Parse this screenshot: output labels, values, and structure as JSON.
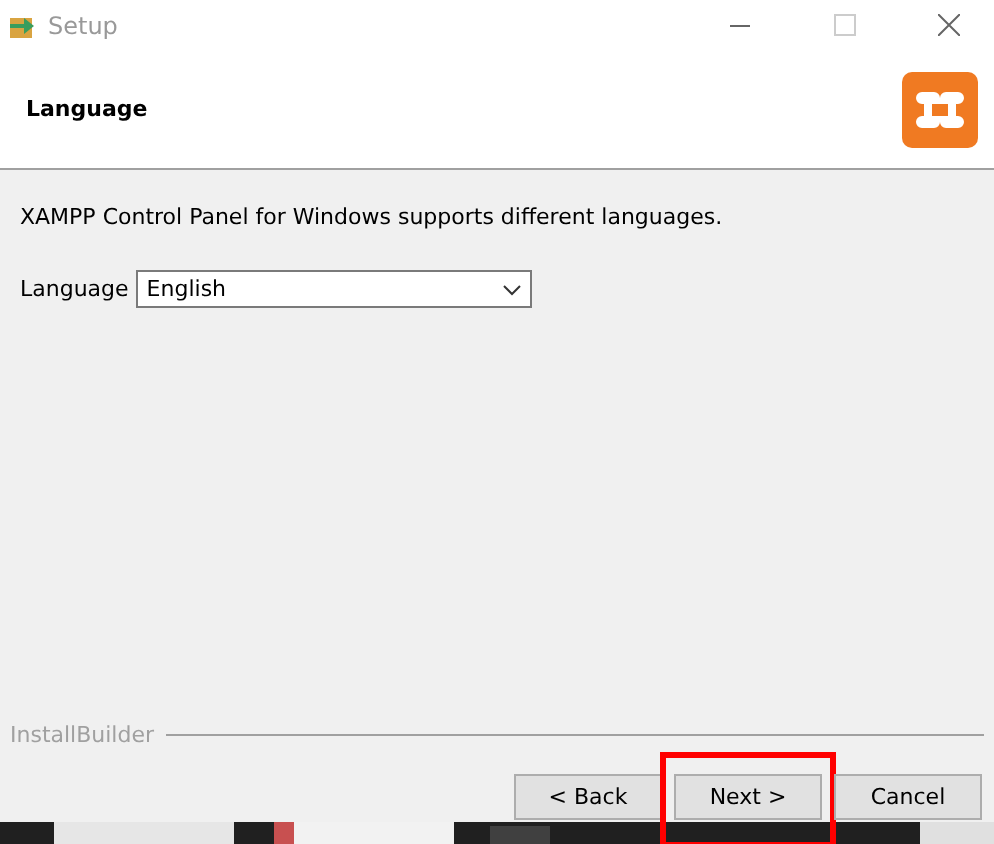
{
  "window": {
    "title": "Setup",
    "active": false
  },
  "header": {
    "title": "Language"
  },
  "body": {
    "description": "XAMPP Control Panel for Windows supports different languages.",
    "language": {
      "label": "Language",
      "value": "English"
    }
  },
  "footer": {
    "brand": "InstallBuilder",
    "buttons": [
      {
        "label": "< Back",
        "highlighted": false
      },
      {
        "label": "Next >",
        "highlighted": true
      },
      {
        "label": "Cancel",
        "highlighted": false
      }
    ]
  }
}
